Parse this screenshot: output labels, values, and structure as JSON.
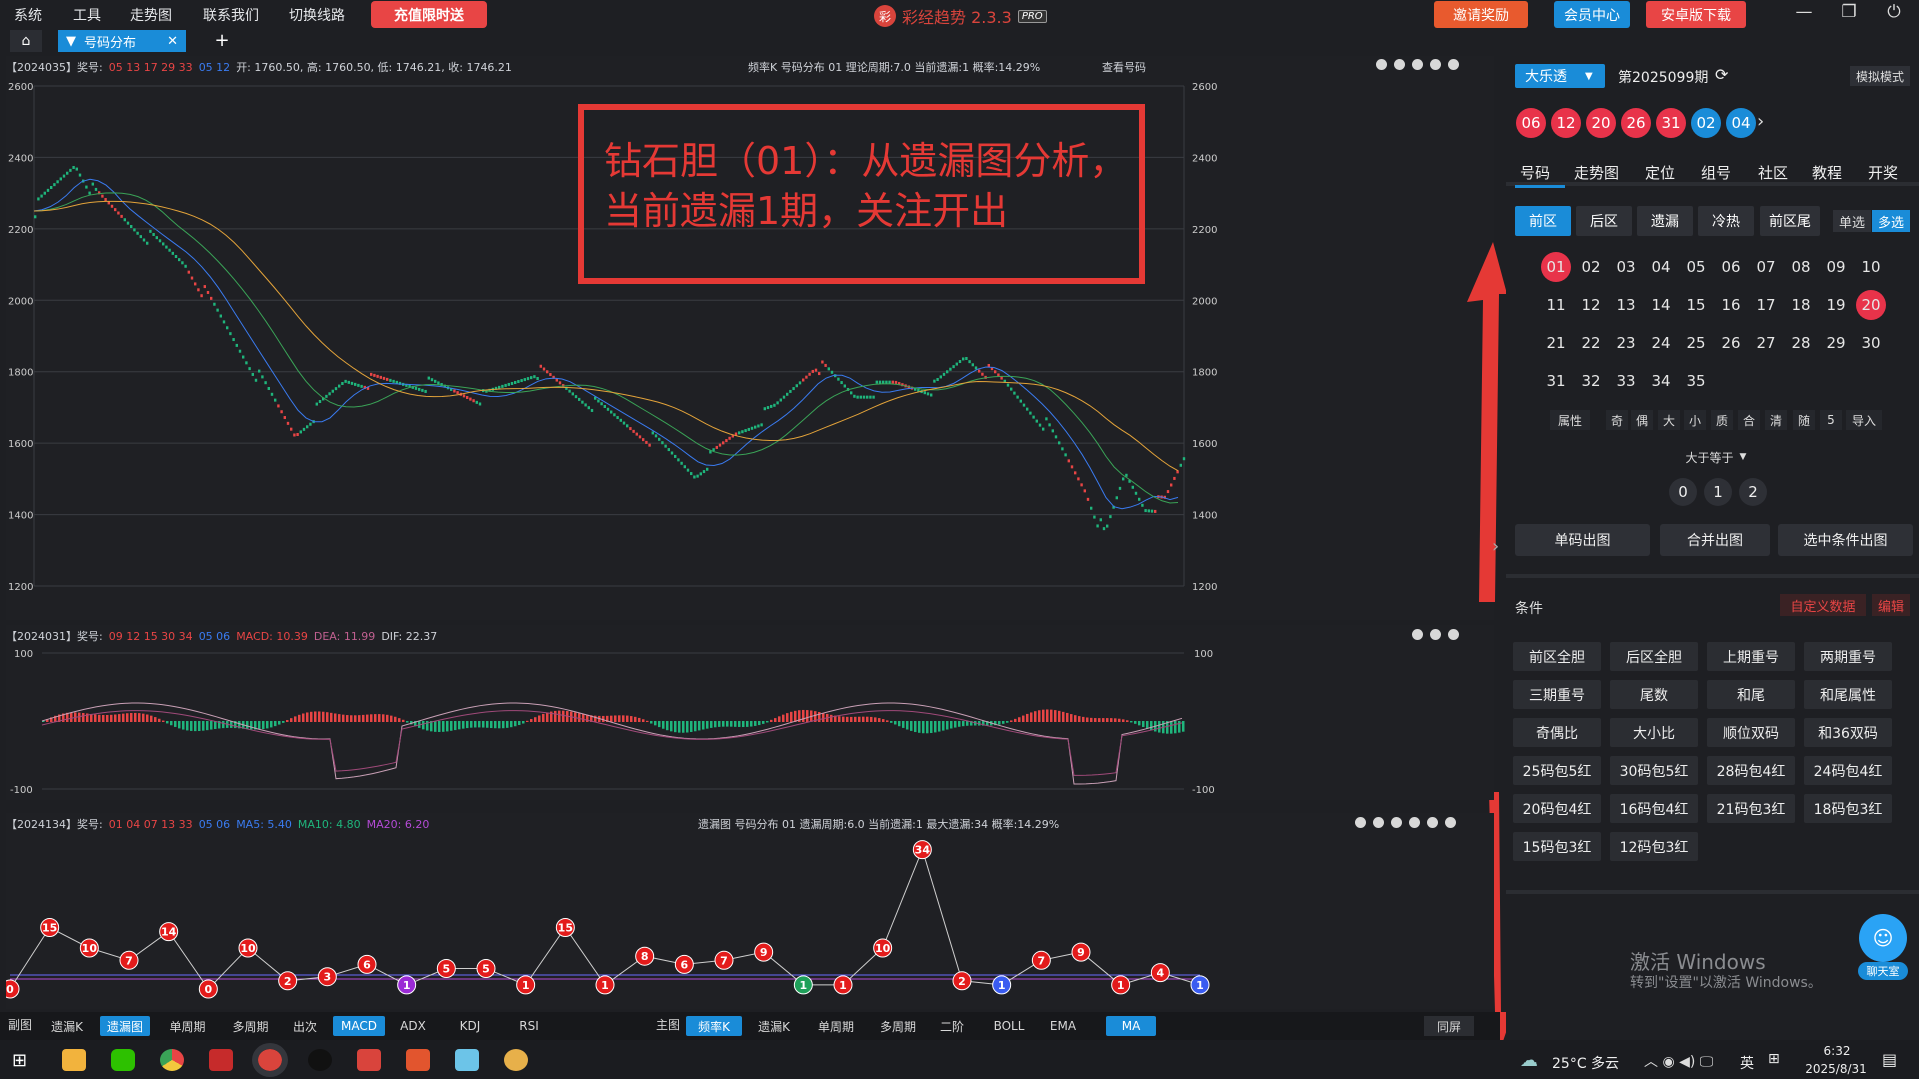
{
  "menu": [
    "系统",
    "工具",
    "走势图",
    "联系我们",
    "切换线路"
  ],
  "promo": "充值限时送",
  "app": {
    "title": "彩经趋势 2.3.3",
    "badge": "PRO",
    "logo": "彩"
  },
  "top_buttons": {
    "invite": "邀请奖励",
    "member": "会员中心",
    "android": "安卓版下载"
  },
  "tab": {
    "label": "号码分布",
    "close": "✕",
    "add": "+",
    "home": "⌂"
  },
  "main": {
    "header_left": "【2024035】奖号:",
    "header_red": "05 13 17 29 33",
    "header_blue": "05 12",
    "header_ohlc": "开: 1760.50, 高: 1760.50, 低: 1746.21, 收: 1746.21",
    "header_center": "频率K 号码分布 01   理论周期:7.0  当前遗漏:1  概率:14.29%",
    "header_link": "查看号码",
    "y_ticks": [
      "2600",
      "2400",
      "2200",
      "2000",
      "1800",
      "1600",
      "1400",
      "1200"
    ]
  },
  "macd": {
    "header_left": "【2024031】奖号:",
    "header_red": "09 12 15 30 34",
    "header_blue": "05 06",
    "header_macd": "MACD: 10.39",
    "header_dea": "DEA: 11.99",
    "header_dif": "DIF: 22.37",
    "y_ticks": [
      "100",
      "-100"
    ]
  },
  "miss": {
    "header_left": "【2024134】奖号:",
    "header_red": "01 04 07 13 33",
    "header_blue": "05 06",
    "header_ma5": "MA5: 5.40",
    "header_ma10": "MA10: 4.80",
    "header_ma20": "MA20: 6.20",
    "header_center": "遗漏图 号码分布 01   遗漏周期:6.0  当前遗漏:1  最大遗漏:34  概率:14.29%",
    "values": [
      0,
      15,
      10,
      7,
      14,
      0,
      10,
      2,
      3,
      6,
      1,
      5,
      5,
      1,
      15,
      1,
      8,
      6,
      7,
      9,
      1,
      1,
      10,
      34,
      2,
      1,
      7,
      9,
      1,
      4,
      1
    ]
  },
  "annotation": "钻石胆（01）：从遗漏图分析，\n当前遗漏1期，关注开出",
  "bottom_sub": {
    "label": "副图",
    "items": [
      "遗漏K",
      "遗漏图",
      "单周期",
      "多周期",
      "出次",
      "MACD",
      "ADX",
      "KDJ",
      "RSI"
    ]
  },
  "bottom_main": {
    "label": "主图",
    "items": [
      "频率K",
      "遗漏K",
      "单周期",
      "多周期",
      "二阶",
      "BOLL",
      "EMA",
      "MA"
    ]
  },
  "bottom_right": "同屏",
  "right": {
    "lottery": "大乐透",
    "period": "第2025099期",
    "sim": "模拟模式",
    "red_balls": [
      "06",
      "12",
      "20",
      "26",
      "31"
    ],
    "blue_balls": [
      "02",
      "04"
    ],
    "tabs": [
      "号码",
      "走势图",
      "定位",
      "组号",
      "社区",
      "教程",
      "开奖"
    ],
    "zone_tabs": [
      "前区",
      "后区",
      "遗漏",
      "冷热",
      "前区尾"
    ],
    "single": "单选",
    "multi": "多选",
    "numbers": [
      "01",
      "02",
      "03",
      "04",
      "05",
      "06",
      "07",
      "08",
      "09",
      "10",
      "11",
      "12",
      "13",
      "14",
      "15",
      "16",
      "17",
      "18",
      "19",
      "20",
      "21",
      "22",
      "23",
      "24",
      "25",
      "26",
      "27",
      "28",
      "29",
      "30",
      "31",
      "32",
      "33",
      "34",
      "35"
    ],
    "selected": [
      "01",
      "20"
    ],
    "attr_row": [
      "属性",
      "奇",
      "偶",
      "大",
      "小",
      "质",
      "合",
      "清",
      "随",
      "5",
      "导入"
    ],
    "gte": "大于等于",
    "gte_vals": [
      "0",
      "1",
      "2"
    ],
    "actions": [
      "单码出图",
      "合并出图",
      "选中条件出图"
    ],
    "cond_label": "条件",
    "custom": "自定义数据",
    "edit": "编辑",
    "conditions": [
      "前区全胆",
      "后区全胆",
      "上期重号",
      "两期重号",
      "三期重号",
      "尾数",
      "和尾",
      "和尾属性",
      "奇偶比",
      "大小比",
      "顺位双码",
      "和36双码",
      "25码包5红",
      "30码包5红",
      "28码包4红",
      "24码包4红",
      "20码包4红",
      "16码包4红",
      "21码包3红",
      "18码包3红",
      "15码包3红",
      "12码包3红"
    ],
    "activate1": "激活 Windows",
    "activate2": "转到\"设置\"以激活 Windows。",
    "chat": "聊天室"
  },
  "taskbar": {
    "weather": "25°C 多云",
    "ime": "英",
    "time": "6:32",
    "date": "2025/8/31"
  }
}
